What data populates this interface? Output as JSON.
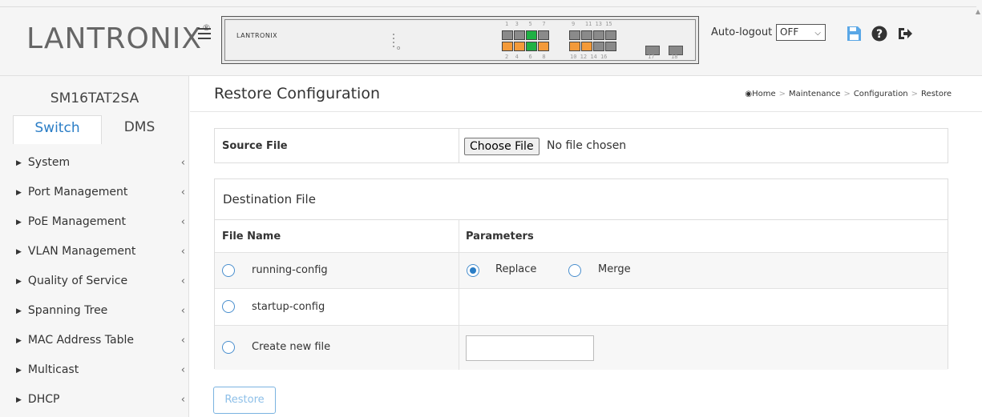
{
  "header": {
    "logo_main": "LANTRONIX",
    "logo_reg": "®",
    "panel_logo": "LANTRONIX",
    "port_numbers_top": [
      "1",
      "3",
      "5",
      "7",
      "9",
      "11",
      "13",
      "15"
    ],
    "port_numbers_bottom": [
      "2",
      "4",
      "6",
      "8",
      "10",
      "12",
      "14",
      "16",
      "17",
      "18"
    ],
    "autologout_label": "Auto-logout",
    "autologout_value": "OFF",
    "icons": [
      "save-icon",
      "help-icon",
      "logout-icon"
    ],
    "colors": {
      "brand_red": "#e31b23",
      "port_orange": "#f39a3a",
      "port_green": "#1fb144",
      "icon_blue": "#2a7dc6"
    }
  },
  "sidebar": {
    "device_name": "SM16TAT2SA",
    "tabs": [
      {
        "label": "Switch",
        "active": true
      },
      {
        "label": "DMS",
        "active": false
      }
    ],
    "items": [
      {
        "label": "System"
      },
      {
        "label": "Port Management"
      },
      {
        "label": "PoE Management"
      },
      {
        "label": "VLAN Management"
      },
      {
        "label": "Quality of Service"
      },
      {
        "label": "Spanning Tree"
      },
      {
        "label": "MAC Address Table"
      },
      {
        "label": "Multicast"
      },
      {
        "label": "DHCP"
      }
    ]
  },
  "main": {
    "title": "Restore Configuration",
    "breadcrumb": [
      "Home",
      "Maintenance",
      "Configuration",
      "Restore"
    ],
    "source": {
      "label": "Source File",
      "button": "Choose File",
      "status": "No file chosen"
    },
    "destination": {
      "title": "Destination File",
      "col_file": "File Name",
      "col_params": "Parameters",
      "rows": [
        {
          "name": "running-config",
          "selected": false
        },
        {
          "name": "startup-config",
          "selected": false
        },
        {
          "name": "Create new file",
          "selected": false
        }
      ],
      "params": [
        {
          "label": "Replace",
          "selected": true
        },
        {
          "label": "Merge",
          "selected": false
        }
      ],
      "new_file_value": ""
    },
    "restore_button": "Restore"
  }
}
